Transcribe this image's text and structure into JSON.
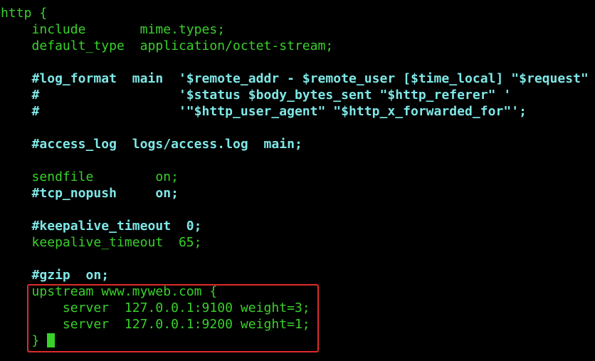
{
  "colors": {
    "background": "#000000",
    "text": "#39d12a",
    "comment": "#7fe7e7",
    "highlight_border": "#e02a2a",
    "cursor": "#39d12a"
  },
  "lines": [
    "http {",
    "    include       mime.types;",
    "    default_type  application/octet-stream;",
    "",
    "    #log_format  main  '$remote_addr - $remote_user [$time_local] \"$request\"",
    "    #                  '$status $body_bytes_sent \"$http_referer\" '",
    "    #                  '\"$http_user_agent\" \"$http_x_forwarded_for\"';",
    "",
    "    #access_log  logs/access.log  main;",
    "",
    "    sendfile        on;",
    "    #tcp_nopush     on;",
    "",
    "    #keepalive_timeout  0;",
    "    keepalive_timeout  65;",
    "",
    "    #gzip  on;",
    "    upstream www.myweb.com {",
    "        server  127.0.0.1:9100 weight=3;",
    "        server  127.0.0.1:9200 weight=1;",
    "    }"
  ]
}
